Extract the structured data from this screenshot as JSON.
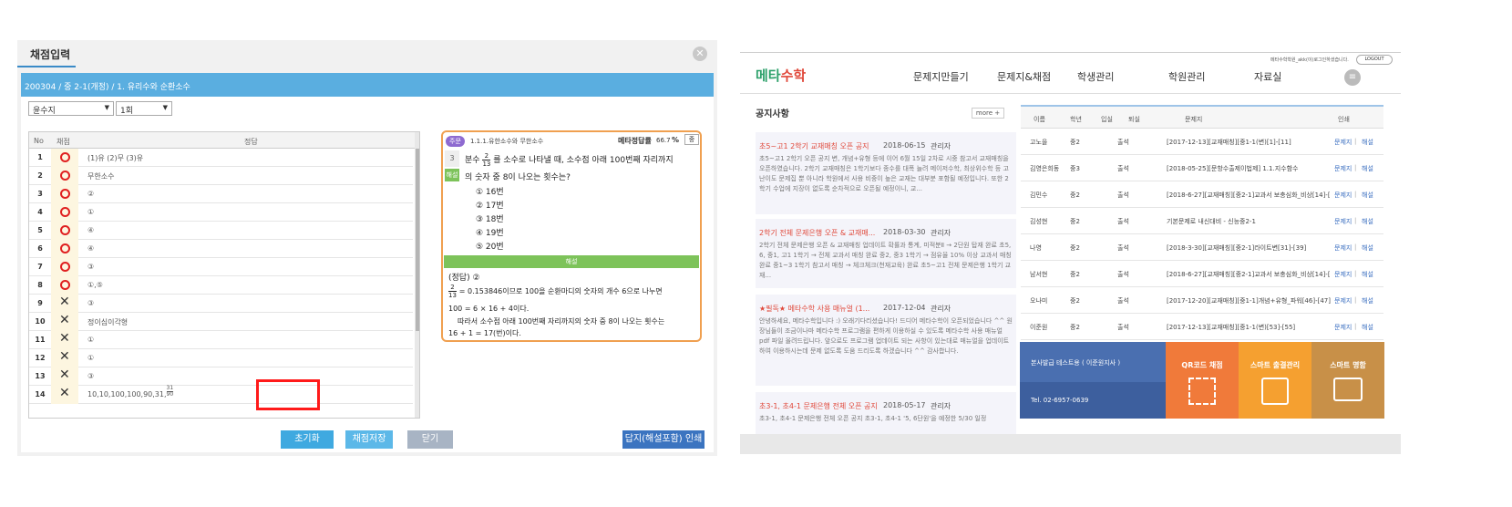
{
  "left": {
    "tab": "채점입력",
    "breadcrumb": "200304 / 중 2-1(개정) / 1. 유리수와 순환소수",
    "select1": "윤수지",
    "select2": "1회",
    "col_no": "No",
    "col_mark": "채점",
    "col_answer": "정답",
    "rows": [
      {
        "no": "1",
        "mark": "O",
        "answer": "(1)유 (2)무 (3)유"
      },
      {
        "no": "2",
        "mark": "O",
        "answer": "무한소수"
      },
      {
        "no": "3",
        "mark": "O",
        "answer": "②"
      },
      {
        "no": "4",
        "mark": "O",
        "answer": "①"
      },
      {
        "no": "5",
        "mark": "O",
        "answer": "④"
      },
      {
        "no": "6",
        "mark": "O",
        "answer": "④"
      },
      {
        "no": "7",
        "mark": "O",
        "answer": "③"
      },
      {
        "no": "8",
        "mark": "O",
        "answer": "①,⑤"
      },
      {
        "no": "9",
        "mark": "X",
        "answer": "③"
      },
      {
        "no": "10",
        "mark": "X",
        "answer": "정이심이각형"
      },
      {
        "no": "11",
        "mark": "X",
        "answer": "①"
      },
      {
        "no": "12",
        "mark": "X",
        "answer": "①"
      },
      {
        "no": "13",
        "mark": "X",
        "answer": "③"
      },
      {
        "no": "14",
        "mark": "X",
        "answer": "10,10,100,100,90,31,",
        "frac_num": "31",
        "frac_den": "90"
      }
    ],
    "question": {
      "badge": "주문",
      "topic": "1.1.1.유한소수와 무한소수",
      "rate_label": "메타정답률",
      "rate_value": "66.7",
      "rate_unit": "%",
      "mini_btn": "중",
      "side_num": "3",
      "side_label": "해설",
      "text_a": "분수",
      "frac_num": "2",
      "frac_den": "13",
      "text_b": "를 소수로 나타낼 때, 소수점 아래 100번째 자리까지",
      "text_c": "의 숫자 중 8이 나오는 횟수는?",
      "options": [
        "①  16번",
        "②  17번",
        "③  18번",
        "④  19번",
        "⑤  20번"
      ],
      "solution_header": "해설",
      "sol_line1": "(정답)  ②",
      "sol_line2": "= 0.153846이므로  100을  순환마디의  숫자의  개수  6으로  나누면",
      "sol_line3": "100 = 6 × 16 + 4이다.",
      "sol_line4": "따라서  소수점  아래  100번째  자리까지의  숫자  중  8이  나오는  횟수는",
      "sol_line5": "16 + 1 = 17(번)이다."
    },
    "buttons": {
      "reset": "초기화",
      "save": "채점저장",
      "close": "닫기",
      "print": "답지(해설포함) 인쇄"
    }
  },
  "right": {
    "logo_a": "메타",
    "logo_b": "수학",
    "user_text": "메타수학학원_akk(이)로그인하셨습니다.",
    "logout": "LOGOUT",
    "nav": [
      "문제지만들기",
      "문제지&채점",
      "학생관리",
      "학원관리",
      "자료실"
    ],
    "notice_title": "공지사항",
    "more": "more +",
    "notices": [
      {
        "title": "초5~고1 2학기 교재매칭 오픈 공지",
        "date": "2018-06-15",
        "author": "관리자",
        "body": "초5~고1 2학기 오픈 공지 변, 개념+유형 등에 이어 6월 15일 2차로 시중 참고서 교재매칭을 오픈하였습니다. 2학기 교재매칭은 1학기보다 종수를 대폭 늘려 메이저수학, 최상위수학 등 고난이도 문제집 뿐 아니라 학원에서 사용 비중이 높은 교재는 대부분 포함될 예정입니다. 또한 2학기 수업에 지장이 없도록 순차적으로 오픈될 예정이니, 교..."
      },
      {
        "title": "2학기 전체 문제은행 오픈 & 교재매...",
        "date": "2018-03-30",
        "author": "관리자",
        "body": "2학기 전체 문제은행 오픈 & 교재매칭 업데이트 확률과 통계, 미적분Ⅱ → 2단원 탑재 완료 초5, 6, 중1, 고1 1학기 → 전체 교과서 매칭 완료 중2, 중3 1학기 → 점유율 10% 이상 교과서 매칭 완료 중1~3 1학기 참고서 매칭 → 체크체크(천재교육) 완료 초5~고1 전체 문제은행 1학기 교재..."
      },
      {
        "title": "★필독★ 메타수학 사용 매뉴얼 (1...",
        "date": "2017-12-04",
        "author": "관리자",
        "body": "안녕하세요, 메타수학입니다 :) 오래기다리셨습니다! 드디어 메타수학이 오픈되었습니다 ^^ 원장님들이 조금이나마 메타수학 프로그램을 편하게 이용하실 수 있도록 메타수학 사용 매뉴얼 pdf 파일 올려드립니다. 앞으로도 프로그램 업데이트 되는 사항이 있는대로 매뉴얼을 업데이트 하여 이용하시는데 문제 없도록 도움 드리도록 하겠습니다 ^^ 감사합니다."
      },
      {
        "title": "초3-1, 초4-1 문제은행 전체 오픈 공지",
        "date": "2018-05-17",
        "author": "관리자",
        "body": "초3-1, 초4-1 문제은행 전체 오픈 공지 초3-1, 초4-1 '5, 6단원'을 예정한 5/30 일정"
      }
    ],
    "table_head": [
      "이름",
      "학년",
      "입실",
      "퇴실",
      "문제지",
      "인쇄"
    ],
    "table_rows": [
      {
        "name": "고노을",
        "grade": "중2",
        "status": "출석",
        "paper": "[2017-12-13][교재매칭][중1-1(변)[1]-[11]"
      },
      {
        "name": "김영은희동",
        "grade": "중3",
        "status": "출석",
        "paper": "[2018-05-25][문항수출제이법제] 1.1.지수함수"
      },
      {
        "name": "김민수",
        "grade": "중2",
        "status": "출석",
        "paper": "[2018-6-27][교재매칭][중2-1]교과서 보충심화_비상[14]-[23]"
      },
      {
        "name": "김성현",
        "grade": "중2",
        "status": "출석",
        "paper": "기본문제로 내신대비 - 신능중2-1"
      },
      {
        "name": "나영",
        "grade": "중2",
        "status": "출석",
        "paper": "[2018-3-30][교재매칭][중2-1]라이트변[31]-[39]"
      },
      {
        "name": "남서현",
        "grade": "중2",
        "status": "출석",
        "paper": "[2018-6-27][교재매칭][중2-1]교과서 보충심화_비상[14]-[23]"
      },
      {
        "name": "오나미",
        "grade": "중2",
        "status": "출석",
        "paper": "[2017-12-20][교재매칭][중1-1]개념+유형_파워[46]-[47]"
      },
      {
        "name": "이준원",
        "grade": "중2",
        "status": "출석",
        "paper": "[2017-12-13][교재매칭][중1-1(변)[53]-[55]"
      }
    ],
    "link_paper": "문제지",
    "link_sol": "해설",
    "link_sep": "|",
    "branch_title": "본사발급 테스트용 ( 이준원지사 )",
    "branch_tel": "Tel. 02-6957-0639",
    "tiles": [
      "QR코드 채점",
      "스마트 출결관리",
      "스마트 명함"
    ],
    "colors": {
      "blue": "#4a6fb0",
      "orange1": "#f07a3a",
      "orange2": "#f5a030",
      "tan": "#c89048"
    }
  }
}
